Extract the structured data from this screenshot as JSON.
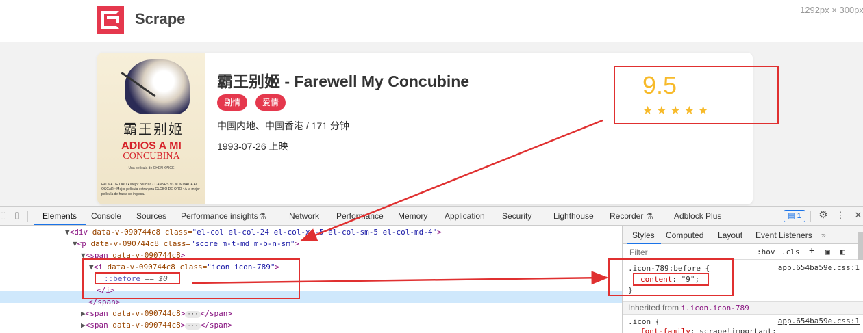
{
  "site": {
    "brand": "Scrape",
    "viewport_size": "1292px × 300px",
    "colors": {
      "accent": "#e5384d",
      "score": "#f7ba2a",
      "annotation": "#e03030"
    }
  },
  "movie": {
    "title": "霸王别姬 - Farewell My Concubine",
    "tags": [
      "剧情",
      "爱情"
    ],
    "region_duration": "中国内地、中国香港 / 171 分钟",
    "release": "1993-07-26 上映",
    "score": "9.5",
    "stars": "★★★★★",
    "rating_stars": 5,
    "poster": {
      "chinese": "霸王别姬",
      "line1": "ADIOS A MI",
      "line2": "CONCUBINA",
      "credit": "Una película de CHEN KAIGE",
      "fine_print": "PALMA DE ORO • Mejor película • CANNES 93 NOMINADA AL OSCAR • Mejor película extranjera GLOBO DE ORO • A la mejor película de habla no inglesa."
    }
  },
  "devtools": {
    "tabs": [
      "Elements",
      "Console",
      "Sources",
      "Performance insights",
      "Network",
      "Performance",
      "Memory",
      "Application",
      "Security",
      "Lighthouse",
      "Recorder",
      "Adblock Plus"
    ],
    "active_tab": "Elements",
    "issues_count": "1",
    "dom": {
      "line1": {
        "open": "<div ",
        "a1": "data-v-090744c8",
        "a2": " class=",
        "v2": "\"el-col el-col-24 el-col-xs-5 el-col-sm-5 el-col-md-4\"",
        "close": ">"
      },
      "line2": {
        "open": "<p ",
        "a1": "data-v-090744c8",
        "a2": " class=",
        "v2": "\"score m-t-md m-b-n-sm\"",
        "close": ">"
      },
      "line3": {
        "open": "<span ",
        "a1": "data-v-090744c8",
        "close": ">"
      },
      "line4": {
        "open": "<i ",
        "a1": "data-v-090744c8",
        "a2": " class=",
        "v2": "\"icon icon-789\"",
        "close": ">"
      },
      "line5": {
        "pseudo": "::before",
        "eq": " == $0"
      },
      "line6": "</i>",
      "line7": "</span>",
      "line8": {
        "open": "<span ",
        "a1": "data-v-090744c8",
        "close": ">",
        "end": "</span>"
      },
      "line9": {
        "open": "<span ",
        "a1": "data-v-090744c8",
        "close": ">",
        "end": "</span>"
      }
    },
    "styles": {
      "tabs": [
        "Styles",
        "Computed",
        "Layout",
        "Event Listeners"
      ],
      "active_tab": "Styles",
      "filter_placeholder": "Filter",
      "hov": ":hov",
      "cls": ".cls",
      "rule1": {
        "selector": ".icon-789:before {",
        "prop": "content",
        "value": "\"9\";",
        "close": "}",
        "source": "app.654ba59e.css:1"
      },
      "inherited_label": "Inherited from ",
      "inherited_ref": "i.icon.icon-789",
      "rule2": {
        "selector": ".icon {",
        "prop": "font-family",
        "value": "scrape!important;",
        "source": "app.654ba59e.css:1"
      }
    }
  }
}
